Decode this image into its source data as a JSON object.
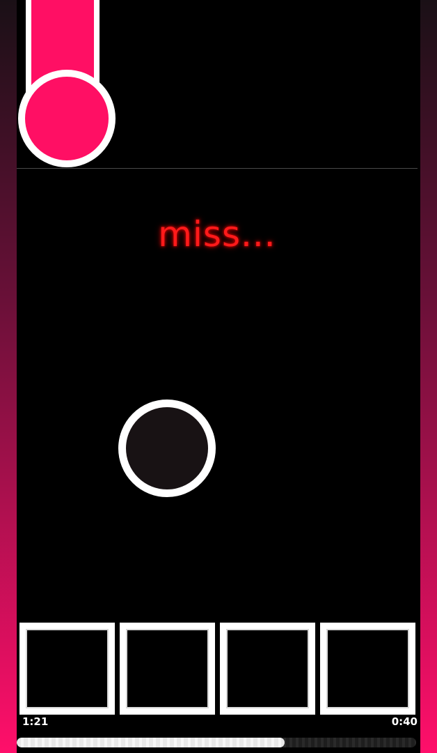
{
  "colors": {
    "accent": "#ff0f64",
    "side_gradient_top": "#1a1016",
    "side_gradient_bottom": "#ff0f6a",
    "note_fill": "#ff0f64",
    "note_outline": "#ffffff",
    "target_fill": "#181214",
    "judgement_color": "#ff1a1a",
    "judgement_glow": "#b40000"
  },
  "judgement": {
    "text": "miss..."
  },
  "lanes": {
    "count": 4
  },
  "timer": {
    "elapsed": "1:21",
    "remaining": "0:40"
  },
  "progress": {
    "fraction": 0.67
  }
}
